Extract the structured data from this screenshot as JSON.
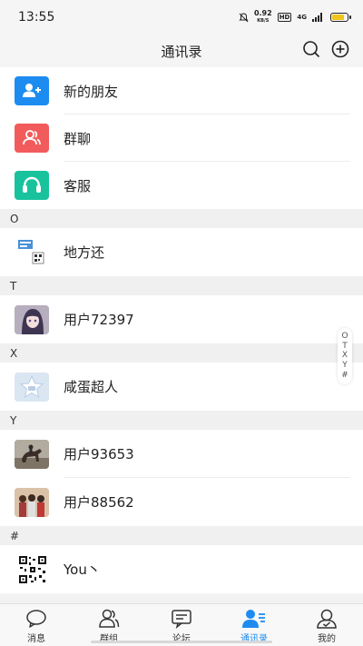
{
  "status_bar": {
    "time": "13:55",
    "net_speed_value": "0.92",
    "net_speed_unit": "KB/S",
    "hd": "HD",
    "signal": "4G"
  },
  "header": {
    "title": "通讯录"
  },
  "top_entries": [
    {
      "label": "新的朋友",
      "icon": "add-friend-icon",
      "color": "#1d8cf0"
    },
    {
      "label": "群聊",
      "icon": "group-chat-icon",
      "color": "#f25b5b"
    },
    {
      "label": "客服",
      "icon": "headset-icon",
      "color": "#18c29c"
    }
  ],
  "sections": [
    {
      "letter": "O",
      "contacts": [
        {
          "name": "地方还",
          "avatar": "qr-card-avatar"
        }
      ]
    },
    {
      "letter": "T",
      "contacts": [
        {
          "name": "用户72397",
          "avatar": "anime-girl-avatar"
        }
      ]
    },
    {
      "letter": "X",
      "contacts": [
        {
          "name": "咸蛋超人",
          "avatar": "star-avatar"
        }
      ]
    },
    {
      "letter": "Y",
      "contacts": [
        {
          "name": "用户93653",
          "avatar": "horse-rider-avatar"
        },
        {
          "name": "用户88562",
          "avatar": "group-photo-avatar"
        }
      ]
    },
    {
      "letter": "#",
      "contacts": [
        {
          "name": "You丶",
          "avatar": "qr-code-avatar"
        }
      ]
    }
  ],
  "index_bar": [
    "O",
    "T",
    "X",
    "Y",
    "#"
  ],
  "tabs": [
    {
      "label": "消息",
      "icon": "message-icon",
      "active": false
    },
    {
      "label": "群组",
      "icon": "groups-icon",
      "active": false
    },
    {
      "label": "论坛",
      "icon": "forum-icon",
      "active": false
    },
    {
      "label": "通讯录",
      "icon": "contacts-icon",
      "active": true
    },
    {
      "label": "我的",
      "icon": "profile-icon",
      "active": false
    }
  ],
  "colors": {
    "accent": "#1d8cf0",
    "tab_active": "#1d8cf0"
  }
}
